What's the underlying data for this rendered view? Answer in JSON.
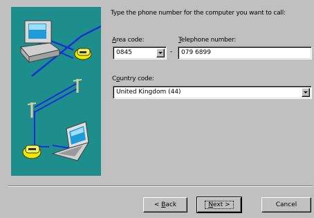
{
  "dialog": {
    "prompt": "Type the phone number for the computer you want to call:"
  },
  "area_code": {
    "label_u": "A",
    "label_rest": "rea code:",
    "value": "0845"
  },
  "phone": {
    "separator": "-",
    "label_u": "T",
    "label_rest": "elephone number:",
    "value": "079 6899"
  },
  "country": {
    "label_pre": "C",
    "label_u": "o",
    "label_rest": "untry code:",
    "value": "United Kingdom (44)"
  },
  "buttons": {
    "back_pre": "< ",
    "back_u": "B",
    "back_rest": "ack",
    "next_u": "N",
    "next_rest": "ext >",
    "cancel": "Cancel"
  },
  "icons": {
    "illustration": "computer-phone-line-illustration-icon",
    "dropdown": "chevron-down-icon"
  },
  "colors": {
    "face": "#c0c0c0",
    "illustration_bg": "#1d8e8b",
    "line": "#0000ff",
    "phone": "#e8e000"
  }
}
